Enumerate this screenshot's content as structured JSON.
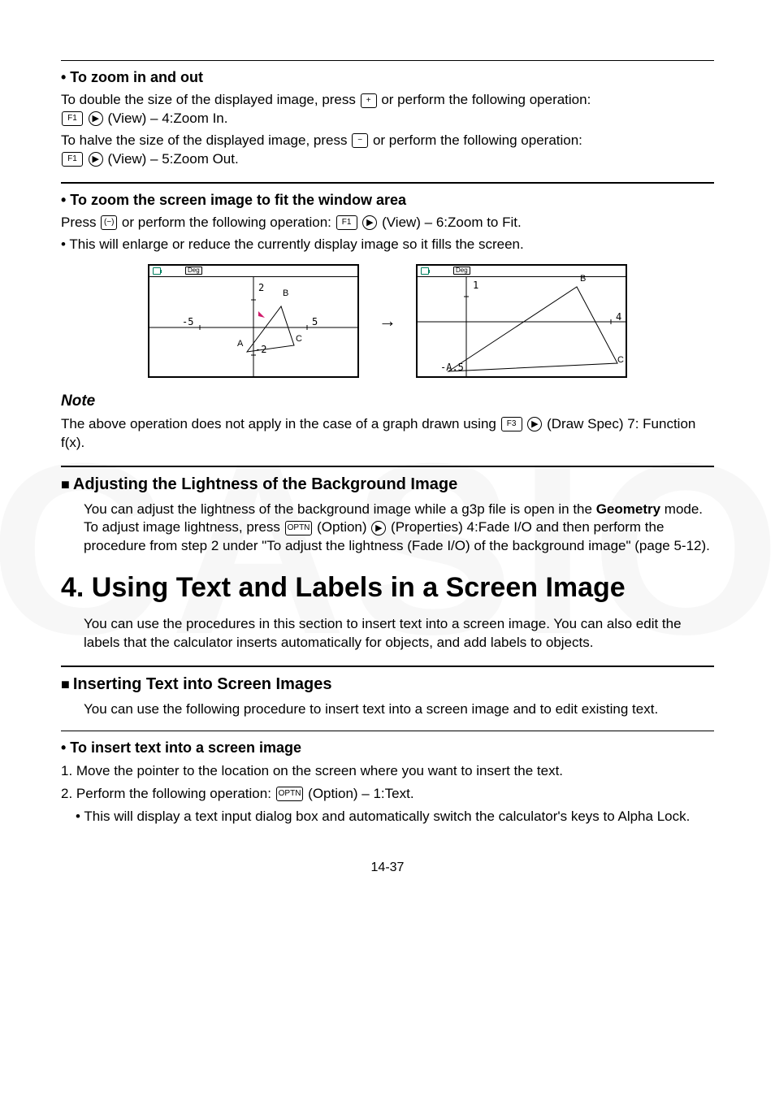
{
  "watermark": "CASIO",
  "sections": {
    "zoom": {
      "title": "• To zoom in and out",
      "p1_a": "To double the size of the displayed image, press ",
      "p1_b": " or perform the following operation:",
      "p1_c": "(View) – 4:Zoom In.",
      "p2_a": "To halve the size of the displayed image, press ",
      "p2_b": " or perform the following operation:",
      "p2_c": "(View) – 5:Zoom Out."
    },
    "fit": {
      "title": "• To zoom the screen image to fit the window area",
      "p1_a": "Press ",
      "p1_b": " or perform the following operation: ",
      "p1_c": "(View) – 6:Zoom to Fit.",
      "bullet": "• This will enlarge or reduce the currently display image so it fills the screen."
    },
    "note": {
      "title": "Note",
      "p_a": "The above operation does not apply in the case of a graph drawn using ",
      "p_b": "(Draw Spec) 7: Function f(x)."
    },
    "lightness": {
      "title": "Adjusting the Lightness of the Background Image",
      "p_a": "You can adjust the lightness of the background image while a g3p file is open in the ",
      "p_bold": "Geometry",
      "p_b": " mode. To adjust image lightness, press ",
      "p_c": "(Option)",
      "p_d": "(Properties) 4:Fade I/O and then perform the procedure from step 2 under \"To adjust the lightness (Fade I/O) of the background image\" (page 5-12)."
    },
    "h4": {
      "title": "4. Using Text and Labels in a Screen Image",
      "p": "You can use the procedures in this section to insert text into a screen image. You can also edit the labels that the calculator inserts automatically for objects, and add labels to objects."
    },
    "inserting": {
      "title": "Inserting Text into Screen Images",
      "p": "You can use the following procedure to insert text into a screen image and to edit existing text."
    },
    "insertproc": {
      "title": "• To insert text into a screen image",
      "step1": "1. Move the pointer to the location on the screen where you want to insert the text.",
      "step2_a": "2. Perform the following operation: ",
      "step2_b": "(Option) – 1:Text.",
      "sub": "• This will display a text input dialog box and automatically switch the calculator's keys to Alpha Lock."
    }
  },
  "keys": {
    "plus": "+",
    "minus": "−",
    "f1": "F1",
    "f3": "F3",
    "optn": "OPTN",
    "right": "▶",
    "neg": "(−)"
  },
  "figures": {
    "arrow": "→",
    "deg": "Deg",
    "left": {
      "xmin": "-5",
      "xmax": "5",
      "ytop": "2",
      "ybot": "-2",
      "A": "A",
      "B": "B",
      "C": "C"
    },
    "right": {
      "ytop": "1",
      "xmax": "4",
      "xminlbl": "-A.5",
      "A": "A",
      "B": "B",
      "C": "C"
    }
  },
  "pageNumber": "14-37"
}
